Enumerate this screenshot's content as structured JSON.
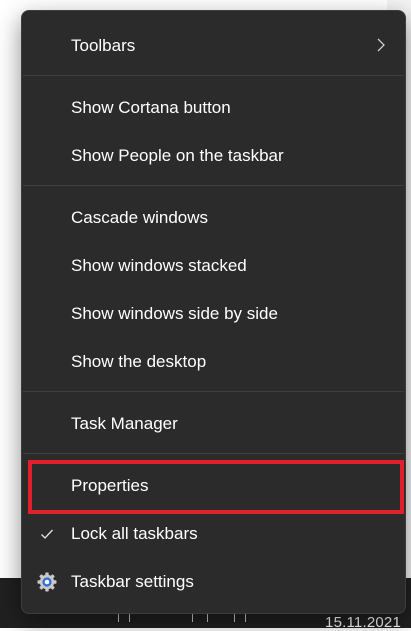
{
  "menu": {
    "items": [
      {
        "label": "Toolbars",
        "has_submenu": true
      },
      {
        "label": "Show Cortana button"
      },
      {
        "label": "Show People on the taskbar"
      },
      {
        "label": "Cascade windows"
      },
      {
        "label": "Show windows stacked"
      },
      {
        "label": "Show windows side by side"
      },
      {
        "label": "Show the desktop"
      },
      {
        "label": "Task Manager"
      },
      {
        "label": "Properties",
        "highlighted": true
      },
      {
        "label": "Lock all taskbars",
        "checked": true
      },
      {
        "label": "Taskbar settings",
        "icon": "gear-icon"
      }
    ]
  },
  "taskbar": {
    "date": "15.11.2021"
  },
  "colors": {
    "menu_bg": "#2b2b2b",
    "highlight": "#e0212b",
    "settings_icon_accent": "#2f6fd6"
  }
}
